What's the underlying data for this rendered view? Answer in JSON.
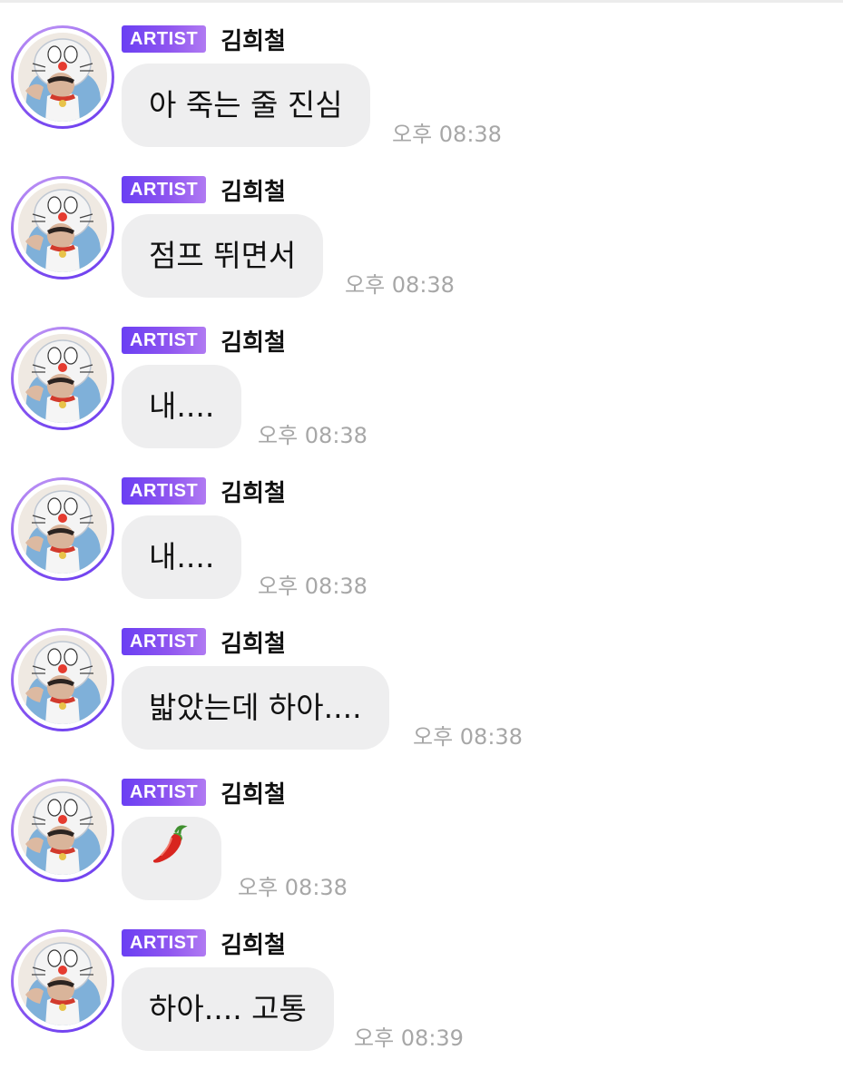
{
  "chat": {
    "messages": [
      {
        "badge": "ARTIST",
        "sender": "김희철",
        "text": "아 죽는 줄 진심",
        "time": "오후 08:38"
      },
      {
        "badge": "ARTIST",
        "sender": "김희철",
        "text": "점프 뛰면서",
        "time": "오후 08:38"
      },
      {
        "badge": "ARTIST",
        "sender": "김희철",
        "text": "내....",
        "time": "오후 08:38"
      },
      {
        "badge": "ARTIST",
        "sender": "김희철",
        "text": "내....",
        "time": "오후 08:38"
      },
      {
        "badge": "ARTIST",
        "sender": "김희철",
        "text": "밟았는데 하아....",
        "time": "오후 08:38"
      },
      {
        "badge": "ARTIST",
        "sender": "김희철",
        "text": "🌶",
        "time": "오후 08:38",
        "emoji_icon": "chili-pepper-icon"
      },
      {
        "badge": "ARTIST",
        "sender": "김희철",
        "text": "하아.... 고통",
        "time": "오후 08:39"
      }
    ]
  },
  "colors": {
    "badge_gradient_start": "#6a3ff3",
    "badge_gradient_end": "#b07af2",
    "bubble_background": "#eeeeef",
    "time_text": "#a7a7a7",
    "avatar_ring": "#8f5cf0"
  }
}
